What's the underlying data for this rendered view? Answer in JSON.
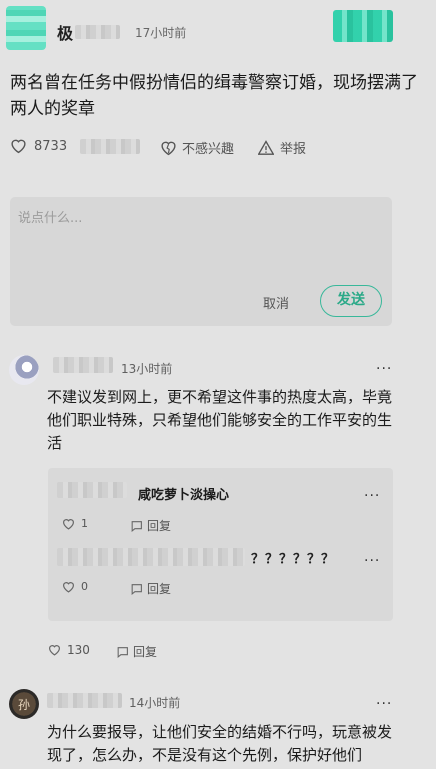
{
  "post": {
    "author_initial": "极",
    "time": "17小时前",
    "title": "两名曾在任务中假扮情侣的缉毒警察订婚，现场摆满了两人的奖章",
    "like_count": "8733",
    "not_interested_label": "不感兴趣",
    "report_label": "举报"
  },
  "comment_box": {
    "placeholder": "说点什么...",
    "cancel_label": "取消",
    "send_label": "发送"
  },
  "comments": [
    {
      "time": "13小时前",
      "text": "不建议发到网上，更不希望这件事的热度太高，毕竟他们职业特殊，只希望他们能够安全的工作平安的生活",
      "like_count": "130",
      "reply_label": "回复",
      "more": "···",
      "replies": [
        {
          "name": "咸吃萝卜淡操心",
          "like_count": "1",
          "reply_label": "回复",
          "more": "···"
        },
        {
          "text": "？？？？？？",
          "like_count": "0",
          "reply_label": "回复",
          "more": "···"
        }
      ]
    },
    {
      "time": "14小时前",
      "text": "为什么要报导，让他们安全的结婚不行吗，玩意被发现了，怎么办，不是没有这个先例，保护好他们",
      "more": "···",
      "avatar_char": "孙"
    }
  ],
  "colors": {
    "accent": "#2aa988",
    "background": "#e3e3e3"
  }
}
